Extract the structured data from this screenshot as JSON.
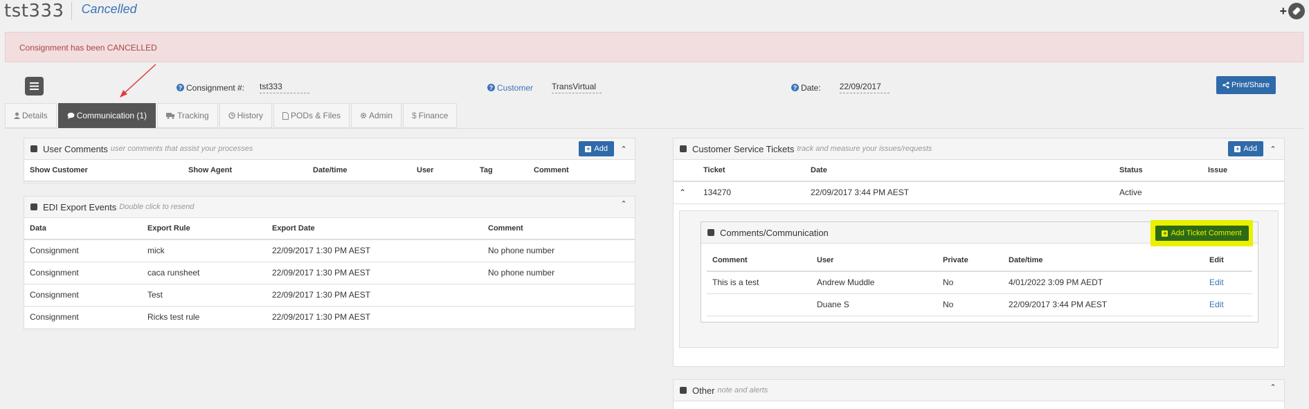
{
  "header": {
    "title": "tst333",
    "status": "Cancelled"
  },
  "alert": {
    "message": "Consignment has been CANCELLED"
  },
  "fields": {
    "consignment_label": "Consignment #:",
    "consignment_value": "tst333",
    "customer_label": "Customer",
    "customer_value": "TransVirtual",
    "date_label": "Date:",
    "date_value": "22/09/2017"
  },
  "print_share_label": "Print/Share",
  "tabs": [
    {
      "label": "Details",
      "icon": "user-icon"
    },
    {
      "label": "Communication (1)",
      "icon": "comment-icon"
    },
    {
      "label": "Tracking",
      "icon": "truck-icon"
    },
    {
      "label": "History",
      "icon": "history-icon"
    },
    {
      "label": "PODs & Files",
      "icon": "file-icon"
    },
    {
      "label": "Admin",
      "icon": "gear-icon"
    },
    {
      "label": "Finance",
      "icon": "dollar-icon"
    }
  ],
  "user_comments": {
    "title": "User Comments",
    "subtitle": "user comments that assist your processes",
    "add_label": "Add",
    "columns": [
      "Show Customer",
      "Show Agent",
      "Date/time",
      "User",
      "Tag",
      "Comment"
    ]
  },
  "edi_export": {
    "title": "EDI Export Events",
    "subtitle": "Double click to resend",
    "columns": [
      "Data",
      "Export Rule",
      "Export Date",
      "Comment"
    ],
    "rows": [
      [
        "Consignment",
        "mick",
        "22/09/2017 1:30 PM AEST",
        "No phone number"
      ],
      [
        "Consignment",
        "caca runsheet",
        "22/09/2017 1:30 PM AEST",
        "No phone number"
      ],
      [
        "Consignment",
        "Test",
        "22/09/2017 1:30 PM AEST",
        ""
      ],
      [
        "Consignment",
        "Ricks test rule",
        "22/09/2017 1:30 PM AEST",
        ""
      ]
    ]
  },
  "cs_tickets": {
    "title": "Customer Service Tickets",
    "subtitle": "track and measure your issues/requests",
    "add_label": "Add",
    "columns": [
      "Ticket",
      "Date",
      "Status",
      "Issue"
    ],
    "row": {
      "ticket": "134270",
      "date": "22/09/2017 3:44 PM AEST",
      "status": "Active",
      "issue": ""
    }
  },
  "comms": {
    "title": "Comments/Communication",
    "add_label": "Add Ticket Comment",
    "columns": [
      "Comment",
      "User",
      "Private",
      "Date/time",
      "Edit"
    ],
    "rows": [
      [
        "This is a test",
        "Andrew Muddle",
        "No",
        "4/01/2022 3:09 PM AEDT",
        "Edit"
      ],
      [
        "",
        "Duane S",
        "No",
        "22/09/2017 3:44 PM AEST",
        "Edit"
      ]
    ]
  },
  "other": {
    "title": "Other",
    "subtitle": "note and alerts"
  },
  "colors": {
    "primary": "#2f6aa9",
    "link": "#3b73b9",
    "alert_bg": "#f2dede",
    "alert_text": "#a94442",
    "highlight": "#e9f000",
    "ticket_btn": "#2d6a16"
  }
}
